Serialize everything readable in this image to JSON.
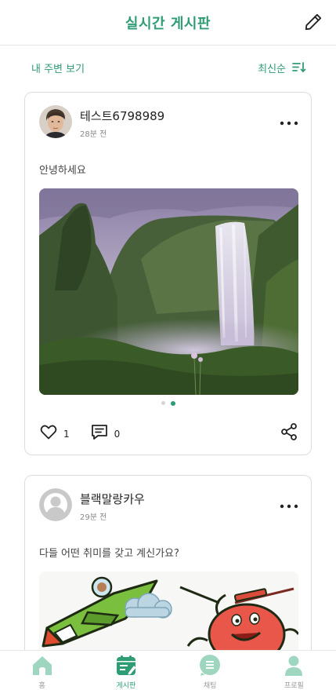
{
  "header": {
    "title": "실시간 게시판",
    "edit_icon": "pencil-icon"
  },
  "subbar": {
    "nearby_label": "내 주변 보기",
    "sort_label": "최신순",
    "sort_icon": "sort-descending-icon"
  },
  "posts": [
    {
      "author": "테스트6798989",
      "time": "28분 전",
      "content": "안녕하세요",
      "image": "waterfall-photo",
      "carousel": {
        "count": 2,
        "active_index": 1
      },
      "likes": "1",
      "comments": "0"
    },
    {
      "author": "블랙말랑카우",
      "time": "29분 전",
      "content": "다들 어떤 취미를 갖고 계신가요?",
      "image": "cartoon-illustration"
    }
  ],
  "bottom_nav": [
    {
      "label": "홈",
      "icon": "home-icon",
      "active": false
    },
    {
      "label": "게시판",
      "icon": "board-icon",
      "active": true
    },
    {
      "label": "채팅",
      "icon": "chat-icon",
      "active": false
    },
    {
      "label": "프로필",
      "icon": "profile-icon",
      "active": false
    }
  ],
  "colors": {
    "accent": "#2f9d73",
    "accent_light": "#9fd6bf"
  }
}
